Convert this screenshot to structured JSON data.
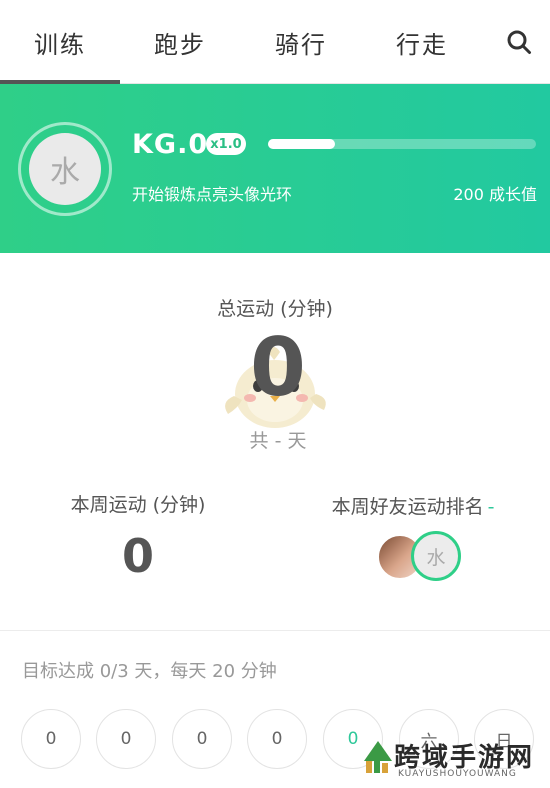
{
  "tabs": [
    {
      "label": "训练"
    },
    {
      "label": "跑步"
    },
    {
      "label": "骑行"
    },
    {
      "label": "行走"
    }
  ],
  "profile": {
    "avatar_text": "水",
    "level": "KG.0",
    "multiplier": "x1.0",
    "progress_fraction": 0.25,
    "hint": "开始锻炼点亮头像光环",
    "growth": "200 成长值"
  },
  "total": {
    "label": "总运动 (分钟)",
    "value": "0",
    "days": "共 - 天"
  },
  "week": {
    "label": "本周运动 (分钟)",
    "value": "0"
  },
  "ranking": {
    "label": "本周好友运动排名",
    "rank": "-",
    "me_avatar_text": "水"
  },
  "goal": {
    "text": "目标达成 0/3 天，每天 20 分钟",
    "days": [
      "0",
      "0",
      "0",
      "0",
      "0",
      "六",
      "日"
    ],
    "today_index": 4
  },
  "watermark": {
    "cn": "跨域手游网",
    "en": "KUAYUSHOUYOUWANG"
  },
  "colors": {
    "accent": "#2fcf88",
    "accent2": "#22c9a0"
  }
}
